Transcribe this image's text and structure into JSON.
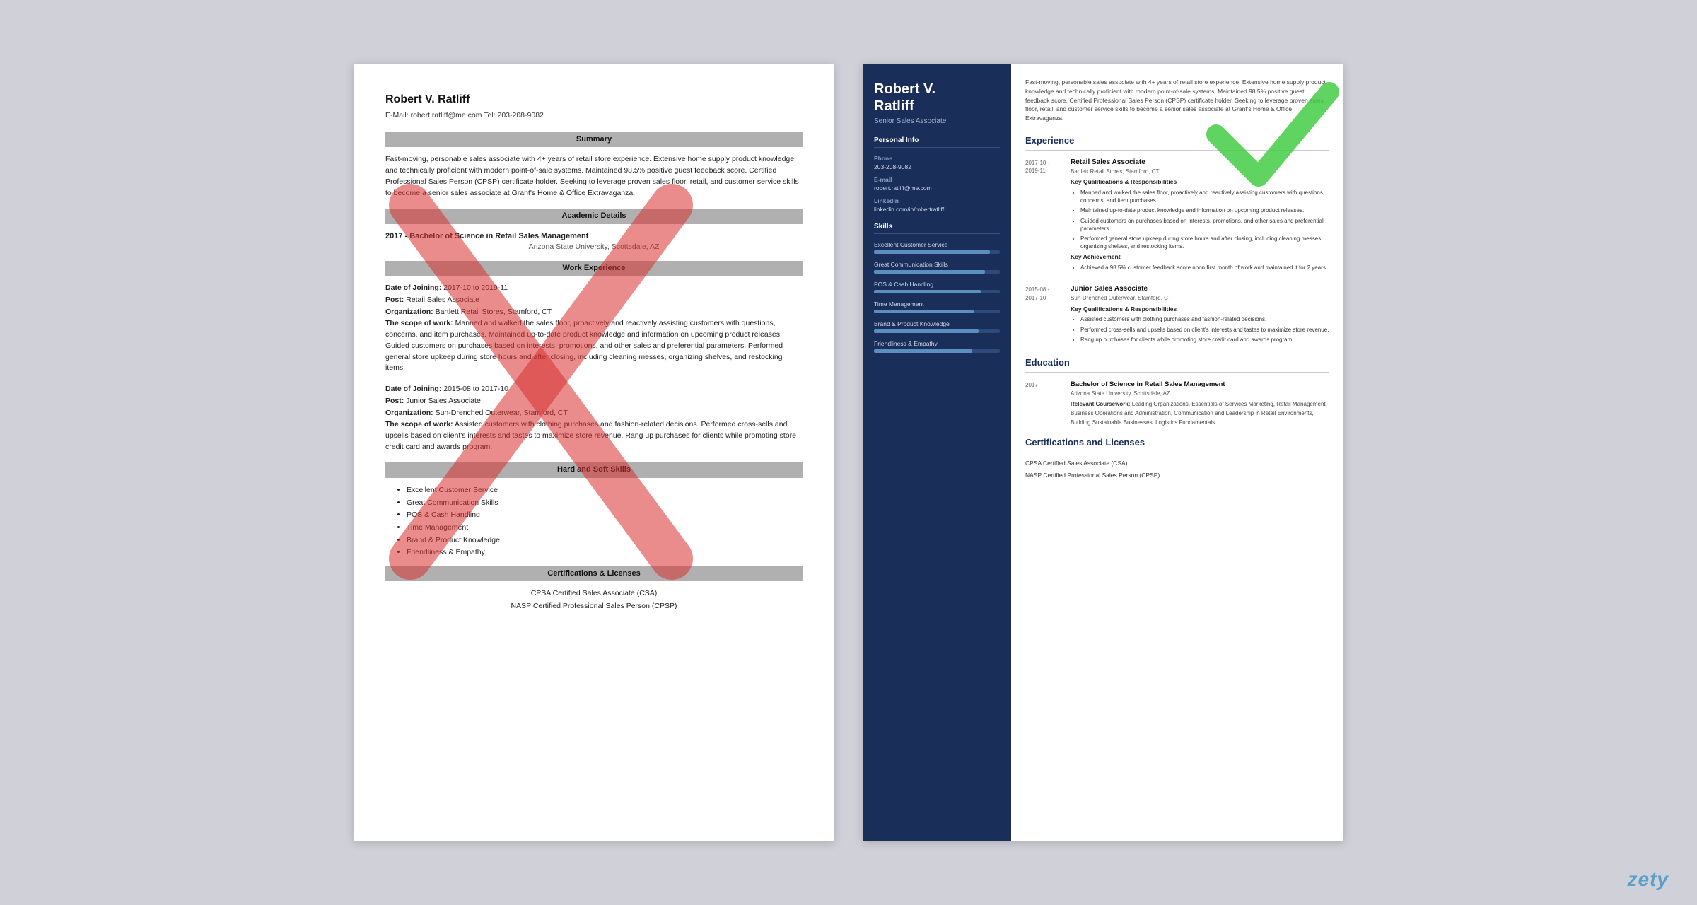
{
  "left_resume": {
    "name": "Robert V. Ratliff",
    "contact": "E-Mail: robert.ratliff@me.com       Tel: 203-208-9082",
    "sections": {
      "summary": {
        "title": "Summary",
        "text": "Fast-moving, personable sales associate with 4+ years of retail store experience. Extensive home supply product knowledge and technically proficient with modern point-of-sale systems. Maintained 98.5% positive guest feedback score. Certified Professional Sales Person (CPSP) certificate holder. Seeking to leverage proven sales floor, retail, and customer service skills to become a senior sales associate at Grant's Home & Office Extravaganza."
      },
      "academic": {
        "title": "Academic Details",
        "year": "2017 -",
        "degree": "Bachelor of Science in Retail Sales Management",
        "school": "Arizona State University, Scottsdale, AZ"
      },
      "work": {
        "title": "Work Experience",
        "entries": [
          {
            "date_label": "Date of Joining:",
            "date_value": "2017-10 to 2019-11",
            "post_label": "Post:",
            "post_value": "Retail Sales Associate",
            "org_label": "Organization:",
            "org_value": "Bartlett Retail Stores, Stamford, CT",
            "scope_label": "The scope of work:",
            "scope_text": "Manned and walked the sales floor, proactively and reactively assisting customers with questions, concerns, and item purchases. Maintained up-to-date product knowledge and information on upcoming product releases. Guided customers on purchases based on interests, promotions, and other sales and preferential parameters. Performed general store upkeep during store hours and after closing, including cleaning messes, organizing shelves, and restocking items."
          },
          {
            "date_label": "Date of Joining:",
            "date_value": "2015-08 to 2017-10",
            "post_label": "Post:",
            "post_value": "Junior Sales Associate",
            "org_label": "Organization:",
            "org_value": "Sun-Drenched Outerwear, Stamford, CT",
            "scope_label": "The scope of work:",
            "scope_text": "Assisted customers with clothing purchases and fashion-related decisions. Performed cross-sells and upsells based on client's interests and tastes to maximize store revenue. Rang up purchases for clients while promoting store credit card and awards program."
          }
        ]
      },
      "skills": {
        "title": "Hard and Soft Skills",
        "items": [
          "Excellent Customer Service",
          "Great Communication Skills",
          "POS & Cash Handling",
          "Time Management",
          "Brand & Product Knowledge",
          "Friendliness & Empathy"
        ]
      },
      "certs": {
        "title": "Certifications & Licenses",
        "items": [
          "CPSA Certified Sales Associate (CSA)",
          "NASP Certified Professional Sales Person (CPSP)"
        ]
      }
    }
  },
  "right_resume": {
    "name": "Robert V.\nRatliff",
    "title": "Senior Sales Associate",
    "sidebar": {
      "personal_info_title": "Personal Info",
      "phone_label": "Phone",
      "phone_value": "203-208-9082",
      "email_label": "E-mail",
      "email_value": "robert.ratliff@me.com",
      "linkedin_label": "LinkedIn",
      "linkedin_value": "linkedin.com/in/robertratliff",
      "skills_title": "Skills",
      "skills": [
        {
          "name": "Excellent Customer Service",
          "pct": 92
        },
        {
          "name": "Great Communication Skills",
          "pct": 88
        },
        {
          "name": "POS & Cash Handling",
          "pct": 85
        },
        {
          "name": "Time Management",
          "pct": 80
        },
        {
          "name": "Brand & Product Knowledge",
          "pct": 83
        },
        {
          "name": "Friendliness & Empathy",
          "pct": 78
        }
      ]
    },
    "main": {
      "summary_text": "Fast-moving, personable sales associate with 4+ years of retail store experience. Extensive home supply product knowledge and technically proficient with modern point-of-sale systems. Maintained 98.5% positive guest feedback score. Certified Professional Sales Person (CPSP) certificate holder. Seeking to leverage proven sales floor, retail, and customer service skills to become a senior sales associate at Grant's Home & Office Extravaganza.",
      "experience_title": "Experience",
      "experience": [
        {
          "dates": "2017-10 -\n2019-11",
          "job_title": "Retail Sales Associate",
          "company": "Bartlett Retail Stores, Stamford, CT",
          "qualifications_label": "Key Qualifications & Responsibilities",
          "bullets": [
            "Manned and walked the sales floor, proactively and reactively assisting customers with questions, concerns, and item purchases.",
            "Maintained up-to-date product knowledge and information on upcoming product releases.",
            "Guided customers on purchases based on interests, promotions, and other sales and preferential parameters.",
            "Performed general store upkeep during store hours and after closing, including cleaning messes, organizing shelves, and restocking items."
          ],
          "achievement_label": "Key Achievement",
          "achievement_bullets": [
            "Achieved a 98.5% customer feedback score upon first month of work and maintained it for 2 years."
          ]
        },
        {
          "dates": "2015-08 -\n2017-10",
          "job_title": "Junior Sales Associate",
          "company": "Sun-Drenched Outerwear, Stamford, CT",
          "qualifications_label": "Key Qualifications & Responsibilities",
          "bullets": [
            "Assisted customers with clothing purchases and fashion-related decisions.",
            "Performed cross-sells and upsells based on client's interests and tastes to maximize store revenue.",
            "Rang up purchases for clients while promoting store credit card and awards program."
          ],
          "achievement_label": "",
          "achievement_bullets": []
        }
      ],
      "education_title": "Education",
      "education": [
        {
          "year": "2017",
          "degree": "Bachelor of Science in Retail Sales Management",
          "school": "Arizona State University, Scottsdale, AZ",
          "coursework_label": "Relevant Coursework:",
          "coursework": "Leading Organizations, Essentials of Services Marketing, Retail Management, Business Operations and Administration, Communication and Leadership in Retail Environments, Building Sustainable Businesses, Logistics Fundamentals"
        }
      ],
      "certs_title": "Certifications and Licenses",
      "certs": [
        "CPSA Certified Sales Associate (CSA)",
        "NASP Certified Professional Sales Person (CPSP)"
      ]
    }
  },
  "watermark": "zety"
}
